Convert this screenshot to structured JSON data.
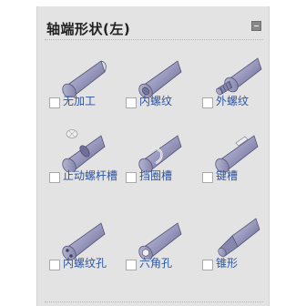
{
  "panel": {
    "title": "轴端形状(左)",
    "items": [
      {
        "label": "无加工",
        "icon": "plain-shaft-end-icon"
      },
      {
        "label": "内螺纹",
        "icon": "internal-thread-shaft-icon"
      },
      {
        "label": "外螺纹",
        "icon": "external-thread-shaft-icon"
      },
      {
        "label": "止动螺杆槽",
        "icon": "stop-screw-groove-shaft-icon"
      },
      {
        "label": "挡圈槽",
        "icon": "retaining-ring-groove-shaft-icon"
      },
      {
        "label": "键槽",
        "icon": "keyway-shaft-icon"
      },
      {
        "label": "内螺纹孔",
        "icon": "tapped-holes-shaft-icon"
      },
      {
        "label": "六角孔",
        "icon": "hex-socket-shaft-icon"
      },
      {
        "label": "锥形",
        "icon": "tapered-shaft-icon"
      }
    ]
  },
  "colors": {
    "panel_bg": "#e3e3e3",
    "label_text": "#2b55a7",
    "title_text": "#222222",
    "shaft_body": "#8f8fb6"
  }
}
